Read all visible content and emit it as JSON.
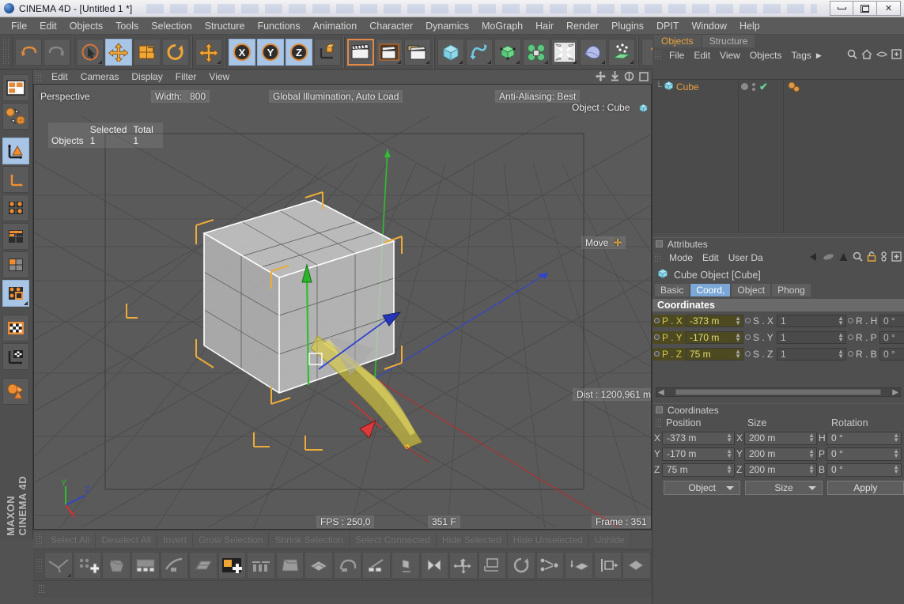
{
  "window": {
    "title": "CINEMA 4D - [Untitled 1 *]",
    "minimize": "minimize",
    "maximize": "maximize",
    "close": "✕"
  },
  "menubar": {
    "items": [
      "File",
      "Edit",
      "Objects",
      "Tools",
      "Selection",
      "Structure",
      "Functions",
      "Animation",
      "Character",
      "Dynamics",
      "MoGraph",
      "Hair",
      "Render",
      "Plugins",
      "DPIT",
      "Window",
      "Help"
    ]
  },
  "toolbar": {
    "groups": [
      {
        "buttons": [
          {
            "name": "undo-icon",
            "state": "normal"
          },
          {
            "name": "redo-icon",
            "state": "disabled"
          }
        ]
      },
      {
        "buttons": [
          {
            "name": "live-selection-icon",
            "state": "normal"
          },
          {
            "name": "move-tool-icon",
            "state": "active"
          },
          {
            "name": "scale-tool-icon",
            "state": "normal"
          },
          {
            "name": "rotate-tool-icon",
            "state": "normal"
          }
        ]
      },
      {
        "buttons": [
          {
            "name": "move-axis-icon",
            "state": "normal"
          }
        ]
      },
      {
        "buttons": [
          {
            "name": "x-axis-lock-icon",
            "label": "X",
            "state": "active"
          },
          {
            "name": "y-axis-lock-icon",
            "label": "Y",
            "state": "active"
          },
          {
            "name": "z-axis-lock-icon",
            "label": "Z",
            "state": "active"
          },
          {
            "name": "world-object-coords-icon",
            "state": "normal"
          }
        ]
      },
      {
        "buttons": [
          {
            "name": "render-view-icon",
            "state": "highlight"
          },
          {
            "name": "render-region-icon",
            "state": "normal"
          },
          {
            "name": "render-settings-icon",
            "state": "normal"
          }
        ]
      },
      {
        "buttons": [
          {
            "name": "primitive-cube-icon",
            "state": "normal"
          },
          {
            "name": "spline-pen-icon",
            "state": "normal"
          },
          {
            "name": "nurbs-icon",
            "state": "normal"
          },
          {
            "name": "array-icon",
            "state": "normal"
          },
          {
            "name": "deformer-icon",
            "state": "normal"
          },
          {
            "name": "scene-object-icon",
            "state": "normal"
          },
          {
            "name": "particles-icon",
            "state": "normal"
          }
        ]
      },
      {
        "buttons": [
          {
            "name": "help-icon",
            "label": "?",
            "state": "normal"
          }
        ]
      }
    ]
  },
  "left_toolbar": {
    "buttons": [
      {
        "name": "make-editable-icon",
        "state": "normal"
      },
      {
        "name": "model-object-mode-icon",
        "state": "normal"
      },
      {
        "name": "model-mode-icon",
        "state": "active"
      },
      {
        "name": "object-axis-mode-icon",
        "state": "normal"
      },
      {
        "name": "point-mode-icon",
        "state": "normal"
      },
      {
        "name": "edge-mode-icon",
        "state": "normal"
      },
      {
        "name": "polygon-mode-icon",
        "state": "normal"
      },
      {
        "name": "texture-mode-icon",
        "state": "active"
      },
      {
        "name": "texture-tool-icon",
        "state": "normal"
      },
      {
        "name": "texture-axis-icon",
        "state": "normal"
      },
      {
        "name": "viewport-solo-icon",
        "state": "normal"
      }
    ],
    "brand_line1": "MAXON",
    "brand_line2": "CINEMA 4D"
  },
  "viewport": {
    "menu": [
      "Edit",
      "Cameras",
      "Display",
      "Filter",
      "View"
    ],
    "menu_icons": [
      "pan-icon",
      "dolly-icon",
      "rotate-view-icon",
      "maximize-view-icon"
    ],
    "camera_label": "Perspective",
    "width_label": "Width:",
    "width_value": "800",
    "render_info": "Global Illumination, Auto Load",
    "antialiasing": "Anti-Aliasing: Best",
    "object_label": "Object : Cube",
    "stats": {
      "col_selected": "Selected",
      "col_total": "Total",
      "row_label": "Objects",
      "selected": "1",
      "total": "1"
    },
    "tool_hint": "Move",
    "distance": "Dist : 1200,961 m",
    "fps": "FPS : 250,0",
    "frame_counter": "351 F",
    "frame": "Frame : 351",
    "axis_x": "X",
    "axis_y": "Y",
    "axis_z": "Z"
  },
  "selection_strip": {
    "buttons": [
      "Select All",
      "Deselect All",
      "Invert",
      "Grow Selection",
      "Shrink Selection",
      "Select Connected",
      "Hide Selected",
      "Hide Unselected",
      "Unhide"
    ]
  },
  "bottom_toolbar": {
    "buttons": [
      {
        "name": "knife-tool-icon"
      },
      {
        "name": "add-points-icon"
      },
      {
        "name": "close-polygon-hole-icon"
      },
      {
        "name": "bridge-icon"
      },
      {
        "name": "brush-icon"
      },
      {
        "name": "create-polygon-icon"
      },
      {
        "name": "extrude-icon"
      },
      {
        "name": "extrude-inner-icon"
      },
      {
        "name": "bevel-icon"
      },
      {
        "name": "matrix-extrude-icon"
      },
      {
        "name": "magnet-tool-icon"
      },
      {
        "name": "slide-icon"
      },
      {
        "name": "normal-move-icon"
      },
      {
        "name": "normal-scale-icon"
      },
      {
        "name": "mirror-icon"
      },
      {
        "name": "move-down-icon"
      },
      {
        "name": "set-point-value-icon"
      },
      {
        "name": "rotate-edge-icon"
      },
      {
        "name": "weld-icon"
      },
      {
        "name": "subdivide-icon"
      },
      {
        "name": "split-icon"
      },
      {
        "name": "disconnect-icon"
      }
    ]
  },
  "object_manager": {
    "tabs": [
      {
        "label": "Objects",
        "active": true
      },
      {
        "label": "Structure",
        "active": false
      }
    ],
    "menu": [
      "File",
      "Edit",
      "View",
      "Objects",
      "Tags"
    ],
    "menu_arrow": "▶",
    "menu_icons": [
      "search-icon",
      "home-icon",
      "eye-icon",
      "fullscreen-icon"
    ],
    "items": [
      {
        "name": "Cube",
        "icon": "cube-object-icon",
        "visible_dot": "●",
        "enabled_check": "✔",
        "tags": "material-tag"
      }
    ]
  },
  "attributes": {
    "panel_title": "Attributes",
    "menu": [
      "Mode",
      "Edit",
      "User Da"
    ],
    "menu_icons": [
      "back-arrow-icon",
      "pill-icon",
      "up-arrow-icon",
      "search-icon",
      "lock-icon",
      "link-icon",
      "plus-box-icon"
    ],
    "object_title": "Cube Object [Cube]",
    "tabs": [
      {
        "label": "Basic",
        "active": false
      },
      {
        "label": "Coord,",
        "active": true
      },
      {
        "label": "Object",
        "active": false
      },
      {
        "label": "Phong",
        "active": false
      }
    ],
    "section_title": "Coordinates",
    "rows": [
      {
        "plabel": "P . X",
        "pvalue": "-373 m",
        "slabel": "S . X",
        "svalue": "1",
        "rlabel": "R . H",
        "rvalue": "0 °"
      },
      {
        "plabel": "P . Y",
        "pvalue": "-170 m",
        "slabel": "S . Y",
        "svalue": "1",
        "rlabel": "R . P",
        "rvalue": "0 °"
      },
      {
        "plabel": "P . Z",
        "pvalue": "75 m",
        "slabel": "S . Z",
        "svalue": "1",
        "rlabel": "R . B",
        "rvalue": "0 °"
      }
    ]
  },
  "coordinates_manager": {
    "panel_title": "Coordinates",
    "columns": [
      "Position",
      "Size",
      "Rotation"
    ],
    "rows": [
      {
        "axis_pos": "X",
        "position": "-373 m",
        "axis_size": "X",
        "size": "200 m",
        "axis_rot": "H",
        "rotation": "0 °"
      },
      {
        "axis_pos": "Y",
        "position": "-170 m",
        "axis_size": "Y",
        "size": "200 m",
        "axis_rot": "P",
        "rotation": "0 °"
      },
      {
        "axis_pos": "Z",
        "position": "75 m",
        "axis_size": "Z",
        "size": "200 m",
        "axis_rot": "B",
        "rotation": "0 °"
      }
    ],
    "select_object": "Object",
    "select_size": "Size",
    "apply_button": "Apply"
  },
  "colors": {
    "accent_orange": "#e8a33d",
    "tab_active_blue": "#7ba7d6",
    "highlight_yellow": "#e2dc72",
    "panel_bg": "#4f4f4f",
    "viewport_bg": "#5a5a5a"
  }
}
